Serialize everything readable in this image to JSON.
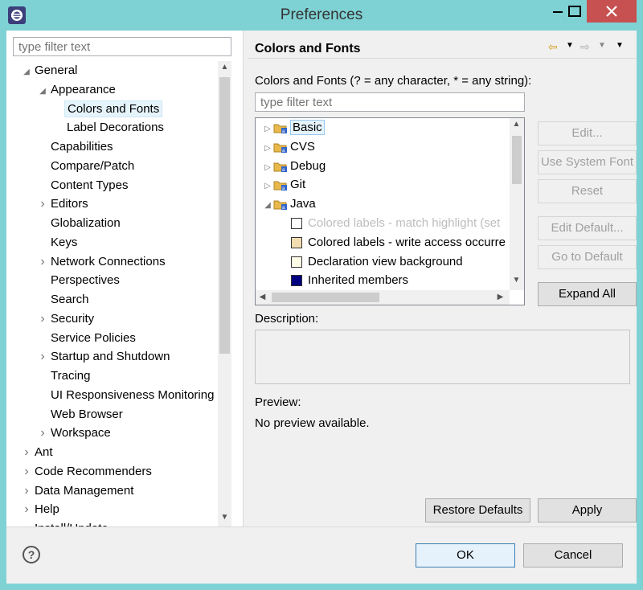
{
  "window": {
    "title": "Preferences",
    "controls": {
      "minimize": "minimize-icon",
      "maximize": "maximize-icon",
      "close": "close-icon"
    }
  },
  "left": {
    "filter_placeholder": "type filter text",
    "tree": [
      {
        "label": "General",
        "expanded": true
      },
      {
        "label": "Appearance",
        "expanded": true
      },
      {
        "label": "Colors and Fonts",
        "selected": true
      },
      {
        "label": "Label Decorations"
      },
      {
        "label": "Capabilities"
      },
      {
        "label": "Compare/Patch"
      },
      {
        "label": "Content Types"
      },
      {
        "label": "Editors",
        "collapsed": true
      },
      {
        "label": "Globalization"
      },
      {
        "label": "Keys"
      },
      {
        "label": "Network Connections",
        "collapsed": true
      },
      {
        "label": "Perspectives"
      },
      {
        "label": "Search"
      },
      {
        "label": "Security",
        "collapsed": true
      },
      {
        "label": "Service Policies"
      },
      {
        "label": "Startup and Shutdown",
        "collapsed": true
      },
      {
        "label": "Tracing"
      },
      {
        "label": "UI Responsiveness Monitoring"
      },
      {
        "label": "Web Browser"
      },
      {
        "label": "Workspace",
        "collapsed": true
      },
      {
        "label": "Ant",
        "collapsed": true
      },
      {
        "label": "Code Recommenders",
        "collapsed": true
      },
      {
        "label": "Data Management",
        "collapsed": true
      },
      {
        "label": "Help",
        "collapsed": true
      },
      {
        "label": "Install/Update",
        "collapsed": true
      }
    ]
  },
  "right": {
    "page_title": "Colors and Fonts",
    "nav_icons": [
      "back-icon",
      "back-menu-icon",
      "forward-icon",
      "forward-menu-icon",
      "view-menu-icon"
    ],
    "heading": "Colors and Fonts (? = any character, * = any string):",
    "filter_placeholder": "type filter text",
    "categories": [
      {
        "label": "Basic",
        "selected": true
      },
      {
        "label": "CVS"
      },
      {
        "label": "Debug"
      },
      {
        "label": "Git"
      },
      {
        "label": "Java",
        "expanded": true
      },
      {
        "label": "Colored labels - match highlight (set",
        "swatch": "#ffffff",
        "dim": true
      },
      {
        "label": "Colored labels - write access occurre",
        "swatch": "#f3dcb0"
      },
      {
        "label": "Declaration view background",
        "swatch": "#fffde7"
      },
      {
        "label": "Inherited members",
        "swatch": "#000080"
      }
    ],
    "buttons": {
      "edit": "Edit...",
      "use_system_font": "Use System Font",
      "reset": "Reset",
      "edit_default": "Edit Default...",
      "go_to_default": "Go to Default",
      "expand_all": "Expand All"
    },
    "description_label": "Description:",
    "description_text": "",
    "preview_label": "Preview:",
    "preview_text": "No preview available.",
    "restore_defaults": "Restore Defaults",
    "apply": "Apply"
  },
  "footer": {
    "help_icon": "help-icon",
    "ok": "OK",
    "cancel": "Cancel"
  }
}
